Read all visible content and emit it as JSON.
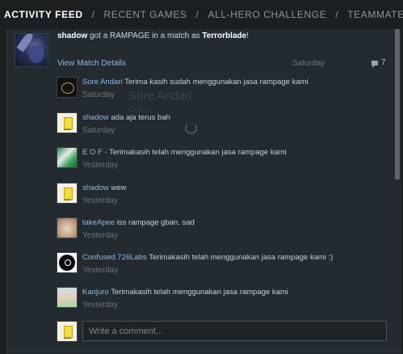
{
  "tabs": [
    {
      "label": "ACTIVITY FEED",
      "active": true
    },
    {
      "label": "RECENT GAMES",
      "active": false
    },
    {
      "label": "ALL-HERO CHALLENGE",
      "active": false
    },
    {
      "label": "TEAMMATES",
      "active": false
    }
  ],
  "tab_separator": "/",
  "post": {
    "player": "shadow",
    "text_before": " got a RAMPAGE in a match as ",
    "hero": "Terrorblade",
    "text_after": "!",
    "view_details_label": "View Match Details",
    "date": "Saturday",
    "comment_count": "7"
  },
  "ghost_overlay": {
    "name": "Sore Andari",
    "subtitle": "Online"
  },
  "comments": [
    {
      "author": "Sore Andari",
      "text": "Terima kasih sudah menggunakan jasa rampage kami",
      "date": "Saturday",
      "avatar": "clock-avatar"
    },
    {
      "author": "shadow",
      "text": "ada aja terus bah",
      "date": "Saturday",
      "avatar": "spongebob-avatar"
    },
    {
      "author": "E O F -",
      "text": "Terimakasih telah menggunakan jasa rampage kami",
      "date": "Yesterday",
      "avatar": "green-avatar"
    },
    {
      "author": "shadow",
      "text": "wew",
      "date": "Yesterday",
      "avatar": "spongebob-avatar"
    },
    {
      "author": "takeApee",
      "text": "iss rampage gban. sad",
      "date": "Yesterday",
      "avatar": "cat-avatar"
    },
    {
      "author": "Confused.726Labs",
      "text": "Terimakasih telah menggunakan jasa rampage kami :)",
      "date": "Yesterday",
      "avatar": "black-circle-avatar"
    },
    {
      "author": "Kanjuro",
      "text": "Terimakasih telah menggunakan jasa rampage kami",
      "date": "Yesterday",
      "avatar": "girl-avatar"
    }
  ],
  "write_comment": {
    "placeholder": "Write a comment...",
    "value": ""
  },
  "colors": {
    "background": "#1b1f22",
    "panel": "#242b30",
    "link": "#8fb8e0",
    "date": "#6c7479"
  }
}
